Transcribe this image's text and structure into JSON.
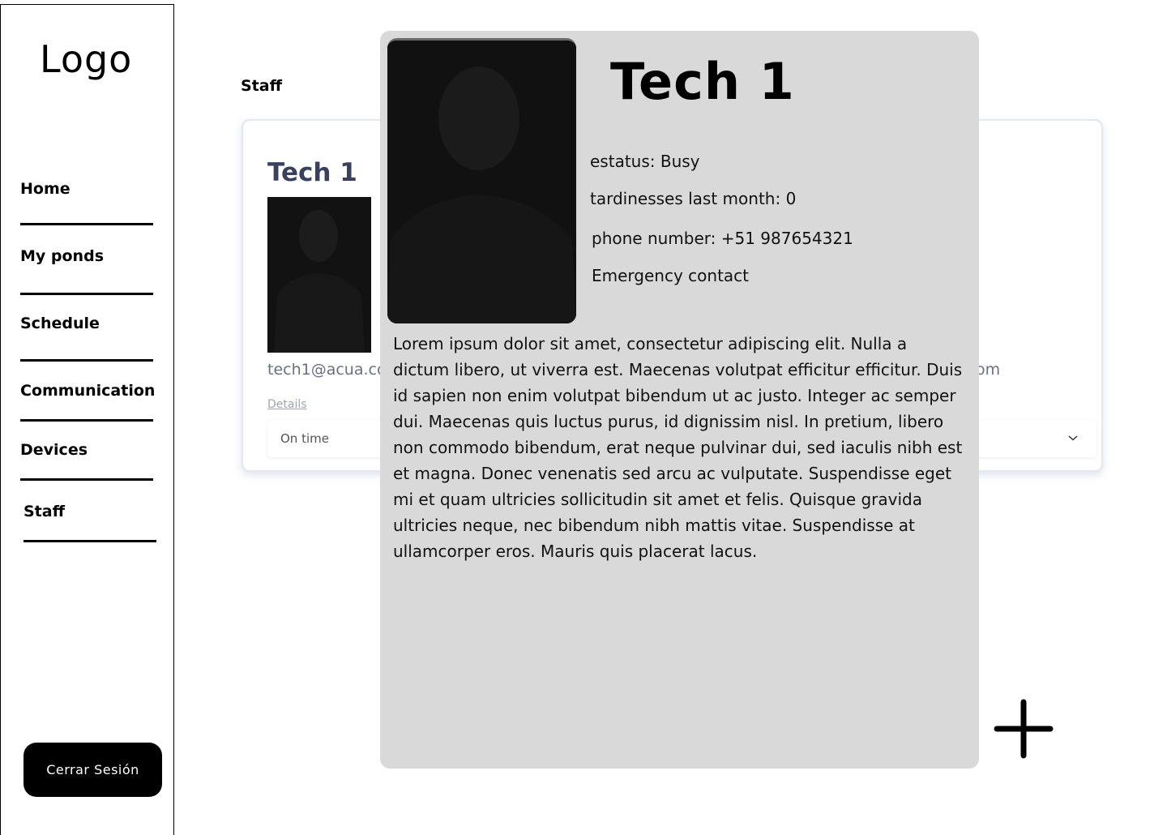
{
  "sidebar": {
    "logo": "Logo",
    "items": [
      {
        "label": "Home"
      },
      {
        "label": "My ponds"
      },
      {
        "label": "Schedule"
      },
      {
        "label": "Communication"
      },
      {
        "label": "Devices"
      },
      {
        "label": "Staff"
      }
    ],
    "logout_label": "Cerrar Sesión"
  },
  "main": {
    "title": "Staff",
    "card": {
      "name": "Tech 1",
      "email": "tech1@acua.co",
      "email_right_fragment": "om",
      "details_label": "Details",
      "status_select": "On time"
    }
  },
  "modal": {
    "name": "Tech 1",
    "status": "estatus: Busy",
    "tardiness": "tardinesses last month: 0",
    "phone": "phone number: +51 987654321",
    "emergency": "Emergency contact",
    "description": "Lorem ipsum dolor sit amet, consectetur adipiscing elit. Nulla a dictum libero, ut viverra est. Maecenas volutpat efficitur efficitur. Duis id sapien non enim volutpat bibendum ut ac justo. Integer ac semper dui. Maecenas quis luctus purus, id dignissim nisl. In pretium, libero non commodo bibendum, erat neque pulvinar dui, sed iaculis nibh est et magna. Donec venenatis sed arcu ac vulputate. Suspendisse eget mi et quam ultricies sollicitudin sit amet et felis. Quisque gravida ultricies neque, nec bibendum nibh mattis vitae. Suspendisse at ullamcorper eros. Mauris quis placerat lacus."
  },
  "icons": {
    "add": "plus-icon",
    "select_arrow": "chevron-down-icon",
    "profile_photo": "person-photo"
  }
}
